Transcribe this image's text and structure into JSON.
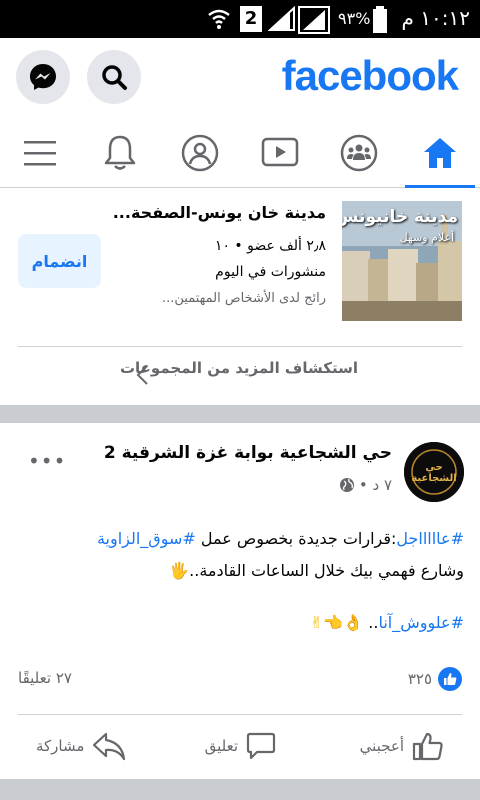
{
  "status_bar": {
    "time": "١٠:١٢ م",
    "battery_percent": "٩٣%",
    "sim_badge": "2"
  },
  "header": {
    "logo": "facebook",
    "accent_color": "#1877f2"
  },
  "tabs": [
    {
      "icon": "home-icon",
      "active": true
    },
    {
      "icon": "groups-icon",
      "active": false
    },
    {
      "icon": "watch-icon",
      "active": false
    },
    {
      "icon": "profile-icon",
      "active": false
    },
    {
      "icon": "bell-icon",
      "active": false
    },
    {
      "icon": "menu-icon",
      "active": false
    }
  ],
  "group_suggestion": {
    "name": "مدينة خان يونس-الصفحة...",
    "meta": "٢٫٨ ألف عضو • ١٠ منشورات في اليوم",
    "hint": "رائج لدى الأشخاص المهتمين...",
    "join_label": "انضمام",
    "thumb_text": "مدينة خانيونس",
    "thumb_subtext": "أعلام وسهل",
    "explore_label": "استكشاف المزيد من المجموعات"
  },
  "post": {
    "author": "حي الشجاعية بوابة غزة الشرقية 2",
    "time": "٧ د •",
    "avatar_text": "حي الشجاعية",
    "line1_hashtag1": "#عاااااجل",
    "line1_text": ":قرارات جديدة بخصوص عمل ",
    "line1_hashtag2": "#سوق_الزاوية",
    "line2_text": "وشارع فهمي بيك خلال الساعات القادمة..",
    "line2_emoji": "🖐",
    "tags_hashtag": "#علووش_آنا",
    "tags_suffix": "..",
    "tags_emoji": "👌👈✌",
    "reaction_count": "٣٢٥",
    "comments_count": "٢٧ تعليقًا",
    "actions": {
      "like": "أعجبني",
      "comment": "تعليق",
      "share": "مشاركة"
    }
  }
}
